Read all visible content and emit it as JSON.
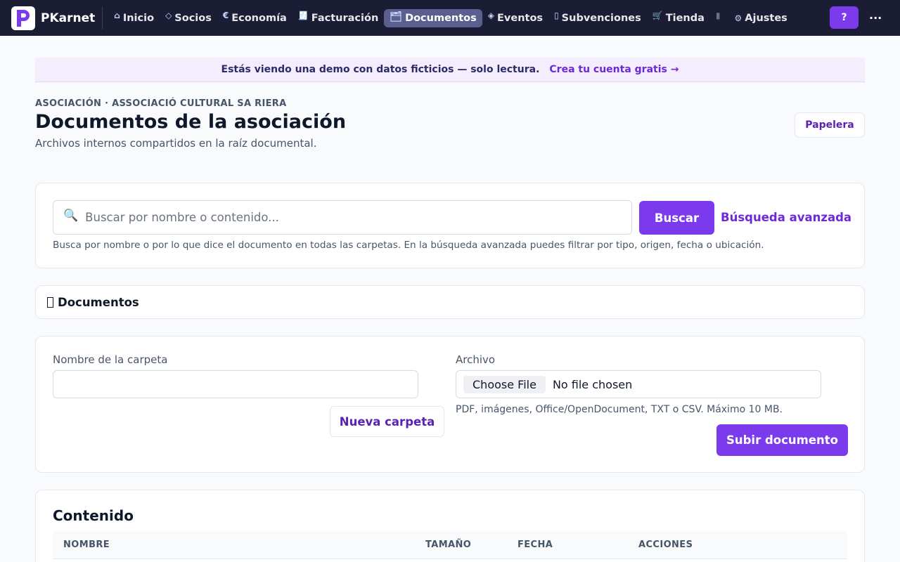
{
  "nav": {
    "brand": "PKarnet",
    "items": [
      {
        "icon": "⌂",
        "label": "Inicio"
      },
      {
        "icon": "◇",
        "label": "Socios"
      },
      {
        "icon": "€",
        "label": "Economía"
      },
      {
        "icon": "🧾",
        "label": "Facturación"
      },
      {
        "icon": "🗂",
        "label": "Documentos"
      },
      {
        "icon": "◈",
        "label": "Eventos"
      },
      {
        "icon": "▯",
        "label": "Subvenciones"
      },
      {
        "icon": "🛒",
        "label": "Tienda"
      },
      {
        "icon": "▮",
        "label": ""
      },
      {
        "icon": "⚙",
        "label": "Ajustes"
      }
    ],
    "active_index": 4,
    "help_label": "?",
    "more_label": "..."
  },
  "banner": {
    "text": "Estás viendo una demo con datos ficticios — solo lectura.",
    "link": "Crea tu cuenta gratis →"
  },
  "header": {
    "eyebrow": "ASOCIACIÓN · ASSOCIACIÓ CULTURAL SA RIERA",
    "title": "Documentos de la asociación",
    "subtitle": "Archivos internos compartidos en la raíz documental.",
    "trash_label": "Papelera"
  },
  "search": {
    "placeholder": "Buscar por nombre o contenido...",
    "button": "Buscar",
    "advanced": "Búsqueda avanzada",
    "help": "Busca por nombre o por lo que dice el documento en todas las carpetas. En la búsqueda avanzada puedes filtrar por tipo, origen, fecha o ubicación."
  },
  "breadcrumb": {
    "label": "Documentos"
  },
  "forms": {
    "folder_label": "Nombre de la carpeta",
    "folder_value": "",
    "new_folder_button": "Nueva carpeta",
    "file_label": "Archivo",
    "choose_file": "Choose File",
    "no_file": "No file chosen",
    "file_help": "PDF, imágenes, Office/OpenDocument, TXT o CSV. Máximo 10 MB.",
    "upload_button": "Subir documento"
  },
  "content": {
    "title": "Contenido",
    "columns": [
      "NOMBRE",
      "TAMAÑO",
      "FECHA",
      "ACCIONES"
    ]
  },
  "colors": {
    "nav_bg": "#1a1d33",
    "accent": "#7c3aed",
    "link": "#6d28d9",
    "banner_bg": "#f3edfd"
  }
}
